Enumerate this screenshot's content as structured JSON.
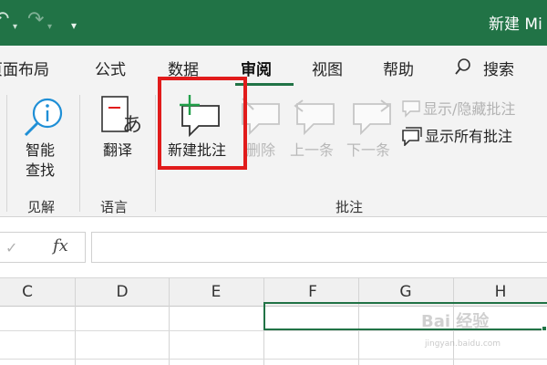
{
  "titlebar": {
    "undo_icon": "undo-icon",
    "redo_icon": "redo-icon",
    "customize_icon": "customize-qat-icon",
    "title": "新建 Mi",
    "background": "#217346"
  },
  "tabs": [
    {
      "label": "页面布局"
    },
    {
      "label": "公式"
    },
    {
      "label": "数据"
    },
    {
      "label": "审阅",
      "active": true
    },
    {
      "label": "视图"
    },
    {
      "label": "帮助"
    }
  ],
  "search": {
    "label": "搜索",
    "icon": "search-icon"
  },
  "ribbon": {
    "smart_lookup": {
      "label_line1": "智能",
      "label_line2": "查找"
    },
    "translate": {
      "label": "翻译"
    },
    "new_comment": {
      "label": "新建批注"
    },
    "delete": {
      "label": "删除"
    },
    "previous": {
      "label": "上一条"
    },
    "next": {
      "label": "下一条"
    },
    "show_hide_comment": {
      "label": "显示/隐藏批注"
    },
    "show_all_comments": {
      "label": "显示所有批注"
    },
    "groups": {
      "insights": "见解",
      "language": "语言",
      "comments": "批注"
    }
  },
  "formula_bar": {
    "check_symbol": "✓",
    "fx_label": "fx",
    "value": ""
  },
  "grid": {
    "columns": [
      "C",
      "D",
      "E",
      "F",
      "G",
      "H"
    ]
  },
  "watermark": {
    "text": "Bai 经验",
    "sub": "jingyan.baidu.com"
  },
  "colors": {
    "accent": "#217346",
    "highlight": "#e11b1b"
  }
}
